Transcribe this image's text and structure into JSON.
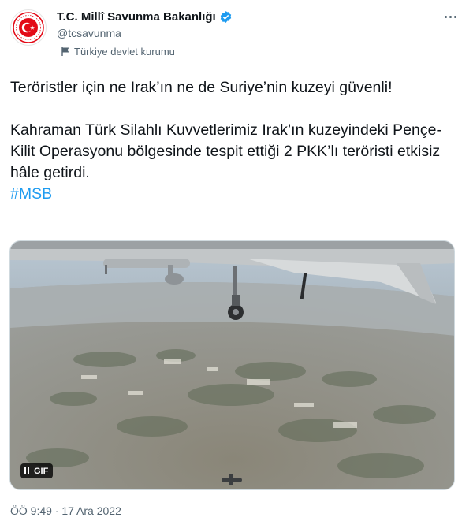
{
  "account": {
    "name": "T.C. Millî Savunma Bakanlığı",
    "handle": "@tcsavunma",
    "label": "Türkiye devlet kurumu"
  },
  "icons": {
    "avatar": "ministry-emblem",
    "verified": "verified-badge-icon",
    "label": "flag-icon",
    "more": "more-options-icon",
    "pause": "pause-icon"
  },
  "colors": {
    "accent": "#1d9bf0",
    "text": "#0f1419",
    "secondary": "#536471",
    "emblem": "#e30a17"
  },
  "tweet": {
    "line1": "Teröristler için ne Irak’ın ne de Suriye’nin kuzeyi güvenli!",
    "line2": "Kahraman Türk Silahlı Kuvvetlerimiz Irak’ın kuzeyindeki Pençe-Kilit Operasyonu bölgesinde tespit ettiği 2 PKK’lı teröristi etkisiz hâle getirdi.",
    "hashtag": "#MSB"
  },
  "media": {
    "gif_label": "GIF"
  },
  "timestamp": "ÖÖ 9:49 · 17 Ara 2022"
}
